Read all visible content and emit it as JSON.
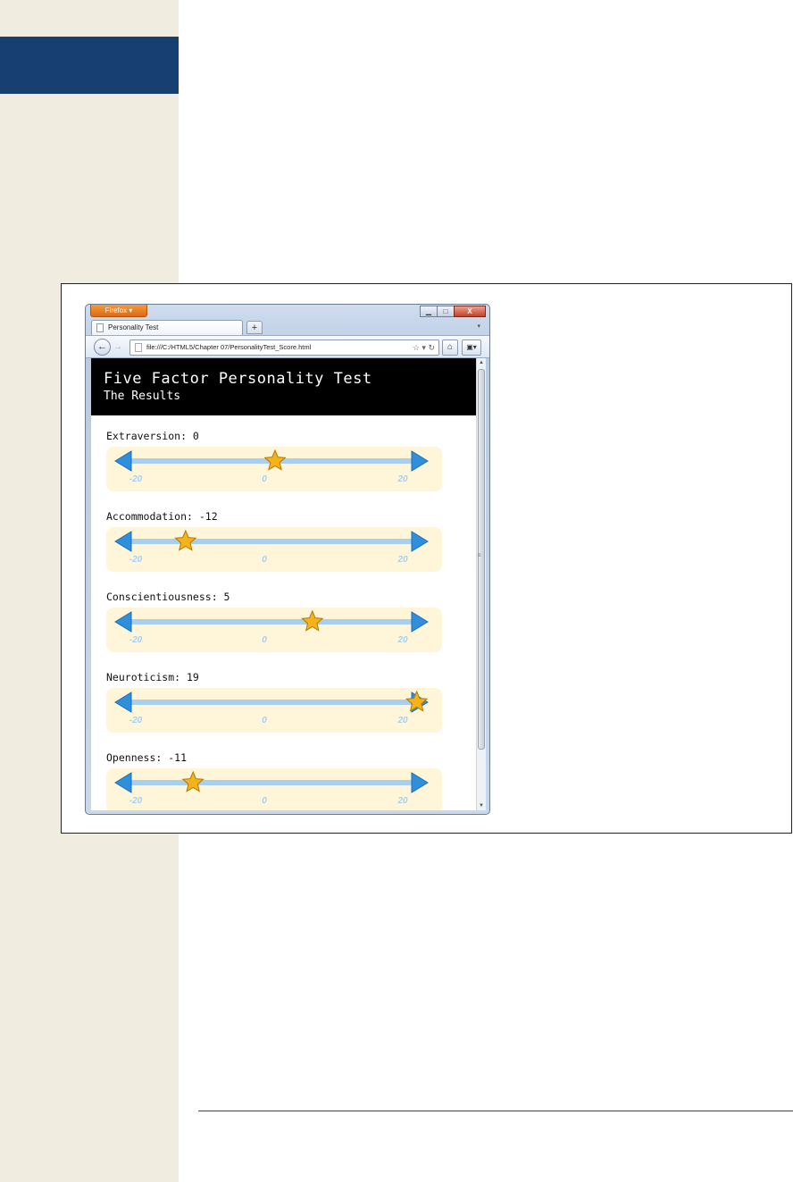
{
  "browser": {
    "menu_button": "Firefox ▾",
    "tab_title": "Personality Test",
    "new_tab": "+",
    "tab_list": "▾",
    "url": "file:///C:/HTML5/Chapter 07/PersonalityTest_Score.html",
    "window_controls": {
      "minimize": "▁",
      "maximize": "□",
      "close": "X"
    }
  },
  "page": {
    "title": "Five Factor Personality Test",
    "subtitle": "The Results"
  },
  "scale": {
    "min": -20,
    "max": 20,
    "ticks": [
      "-20",
      "0",
      "20"
    ]
  },
  "traits": [
    {
      "label": "Extraversion: 0",
      "score": 0
    },
    {
      "label": "Accommodation: -12",
      "score": -12
    },
    {
      "label": "Conscientiousness: 5",
      "score": 5
    },
    {
      "label": "Neuroticism: 19",
      "score": 19
    },
    {
      "label": "Openness: -11",
      "score": -11
    }
  ],
  "colors": {
    "margin": "#f0ece0",
    "chapter_tab": "#173f72",
    "scale_bg": "#fff6d9",
    "scale_line": "#a8cfee",
    "arrow": "#2f8fdc",
    "star": "#f5b31a"
  }
}
